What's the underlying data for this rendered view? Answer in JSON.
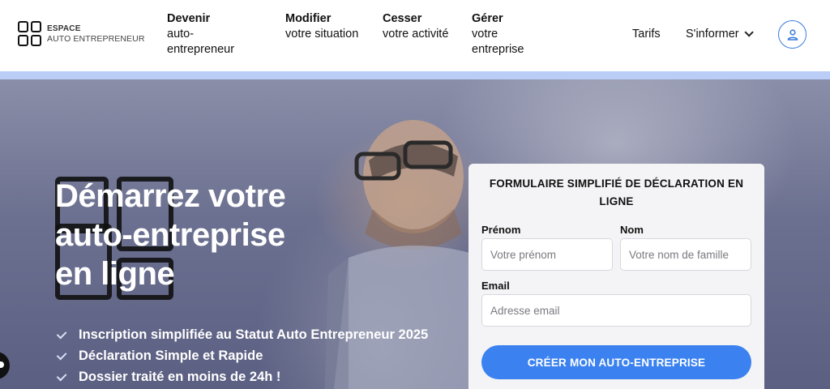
{
  "logo": {
    "line1": "ESPACE",
    "line2": "AUTO ENTREPRENEUR"
  },
  "nav": [
    {
      "title": "Devenir",
      "sub": "auto-entrepreneur"
    },
    {
      "title": "Modifier",
      "sub": "votre situation"
    },
    {
      "title": "Cesser",
      "sub": "votre activité"
    },
    {
      "title": "Gérer",
      "sub": "votre entreprise"
    }
  ],
  "links": {
    "tarifs": "Tarifs",
    "informer": "S'informer"
  },
  "icons": {
    "account": "user-icon",
    "chevron": "chevron-down-icon",
    "check": "check-icon",
    "chat": "chat-icon"
  },
  "hero": {
    "title_lines": [
      "Démarrez votre",
      "auto-entreprise",
      "en ligne"
    ],
    "features": [
      "Inscription simplifiée au Statut Auto Entrepreneur 2025",
      "Déclaration Simple et Rapide",
      "Dossier traité en moins de 24h !"
    ]
  },
  "form": {
    "title": "FORMULAIRE SIMPLIFIÉ DE DÉCLARATION EN LIGNE",
    "prenom_label": "Prénom",
    "prenom_placeholder": "Votre prénom",
    "nom_label": "Nom",
    "nom_placeholder": "Votre nom de famille",
    "email_label": "Email",
    "email_placeholder": "Adresse email",
    "submit_label": "CRÉER MON AUTO-ENTREPRISE"
  },
  "colors": {
    "accent": "#3b82f0",
    "logo_red": "#e53935",
    "logo_green": "#43a047",
    "logo_yellow": "#f9a825",
    "logo_blue": "#1e88e5"
  }
}
